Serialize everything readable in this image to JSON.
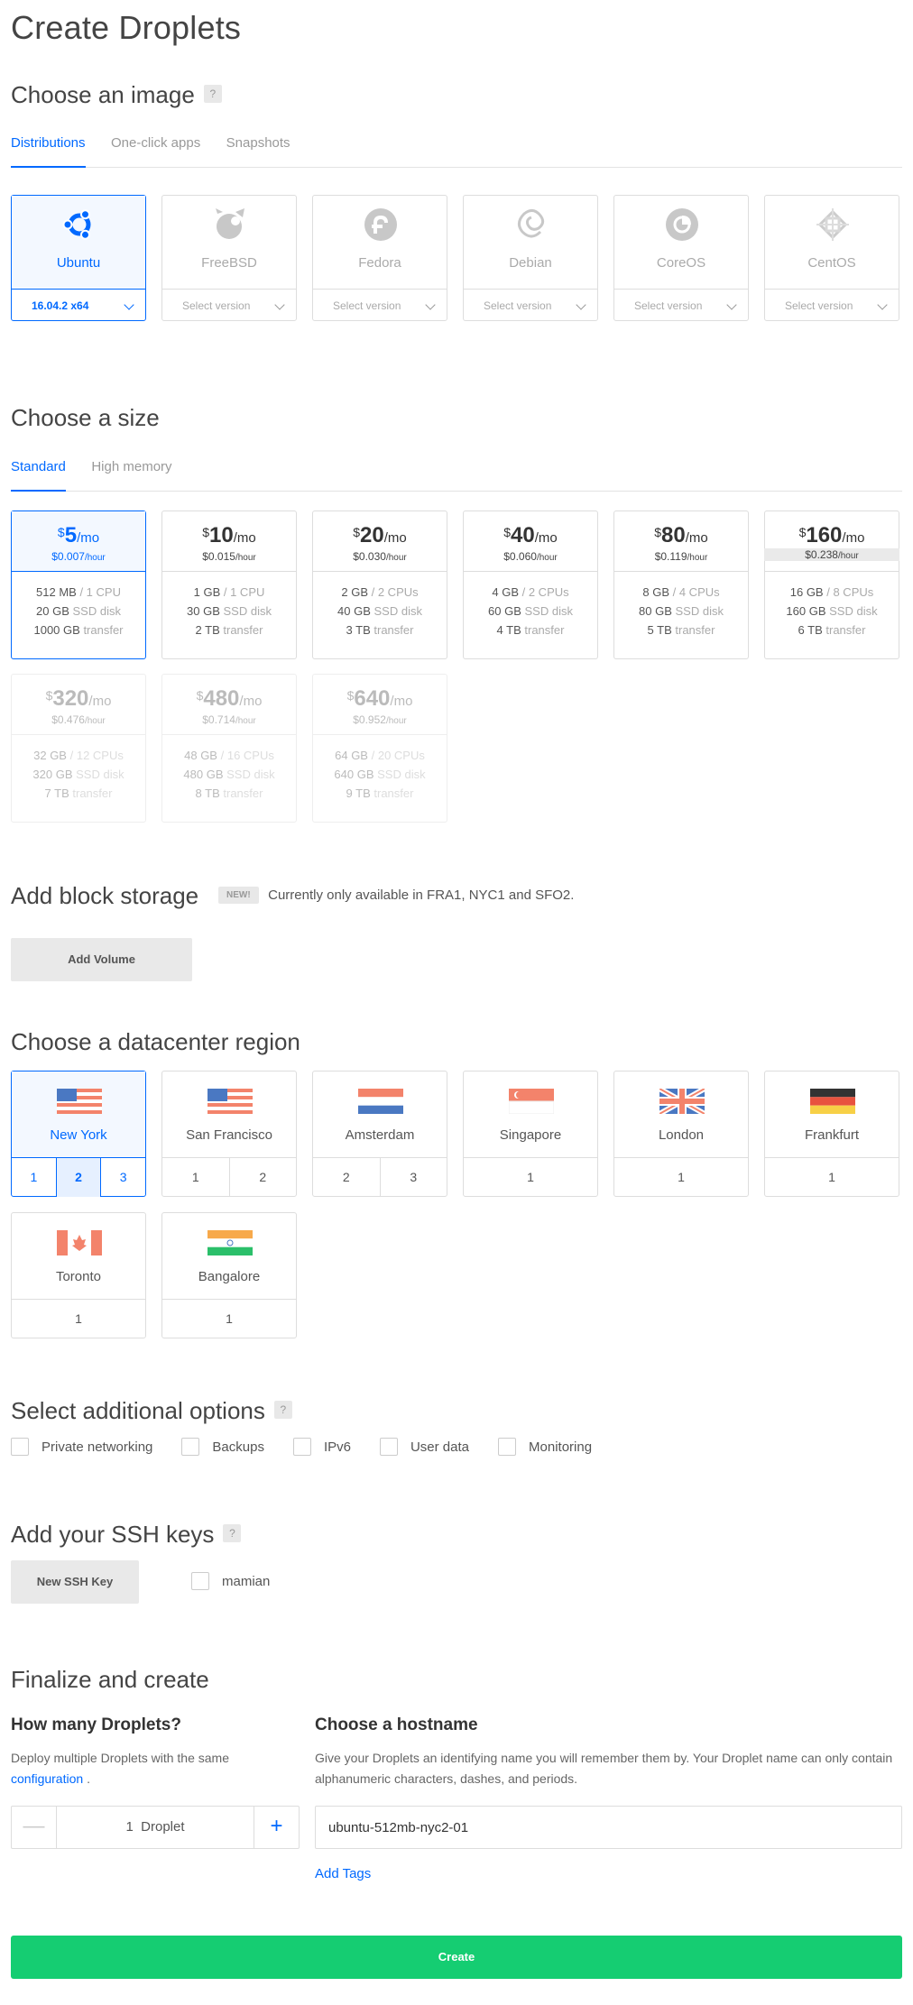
{
  "page_title": "Create Droplets",
  "image_section": {
    "title": "Choose an image",
    "help": "?",
    "tabs": [
      "Distributions",
      "One-click apps",
      "Snapshots"
    ],
    "cards": [
      {
        "name": "Ubuntu",
        "version": "16.04.2 x64",
        "icon": "ubuntu-icon"
      },
      {
        "name": "FreeBSD",
        "version": "Select version",
        "icon": "freebsd-icon"
      },
      {
        "name": "Fedora",
        "version": "Select version",
        "icon": "fedora-icon"
      },
      {
        "name": "Debian",
        "version": "Select version",
        "icon": "debian-icon"
      },
      {
        "name": "CoreOS",
        "version": "Select version",
        "icon": "coreos-icon"
      },
      {
        "name": "CentOS",
        "version": "Select version",
        "icon": "centos-icon"
      }
    ]
  },
  "size_section": {
    "title": "Choose a size",
    "tabs": [
      "Standard",
      "High memory"
    ],
    "currency": "$",
    "per_month": "/mo",
    "per_hour": "/hour",
    "plans": [
      {
        "price": "5",
        "hourly": "$0.007",
        "mem": "512 MB",
        "cpu": "/ 1 CPU",
        "disk": "20 GB",
        "disk_label": "SSD disk",
        "transfer": "1000 GB",
        "transfer_label": "transfer"
      },
      {
        "price": "10",
        "hourly": "$0.015",
        "mem": "1 GB",
        "cpu": "/ 1 CPU",
        "disk": "30 GB",
        "disk_label": "SSD disk",
        "transfer": "2 TB",
        "transfer_label": "transfer"
      },
      {
        "price": "20",
        "hourly": "$0.030",
        "mem": "2 GB",
        "cpu": "/ 2 CPUs",
        "disk": "40 GB",
        "disk_label": "SSD disk",
        "transfer": "3 TB",
        "transfer_label": "transfer"
      },
      {
        "price": "40",
        "hourly": "$0.060",
        "mem": "4 GB",
        "cpu": "/ 2 CPUs",
        "disk": "60 GB",
        "disk_label": "SSD disk",
        "transfer": "4 TB",
        "transfer_label": "transfer"
      },
      {
        "price": "80",
        "hourly": "$0.119",
        "mem": "8 GB",
        "cpu": "/ 4 CPUs",
        "disk": "80 GB",
        "disk_label": "SSD disk",
        "transfer": "5 TB",
        "transfer_label": "transfer"
      },
      {
        "price": "160",
        "hourly": "$0.238",
        "mem": "16 GB",
        "cpu": "/ 8 CPUs",
        "disk": "160 GB",
        "disk_label": "SSD disk",
        "transfer": "6 TB",
        "transfer_label": "transfer"
      },
      {
        "price": "320",
        "hourly": "$0.476",
        "mem": "32 GB",
        "cpu": "/ 12 CPUs",
        "disk": "320 GB",
        "disk_label": "SSD disk",
        "transfer": "7 TB",
        "transfer_label": "transfer"
      },
      {
        "price": "480",
        "hourly": "$0.714",
        "mem": "48 GB",
        "cpu": "/ 16 CPUs",
        "disk": "480 GB",
        "disk_label": "SSD disk",
        "transfer": "8 TB",
        "transfer_label": "transfer"
      },
      {
        "price": "640",
        "hourly": "$0.952",
        "mem": "64 GB",
        "cpu": "/ 20 CPUs",
        "disk": "640 GB",
        "disk_label": "SSD disk",
        "transfer": "9 TB",
        "transfer_label": "transfer"
      }
    ]
  },
  "storage_section": {
    "title": "Add block storage",
    "badge": "NEW!",
    "note": "Currently only available in FRA1, NYC1 and SFO2.",
    "button": "Add Volume"
  },
  "region_section": {
    "title": "Choose a datacenter region",
    "regions": [
      {
        "name": "New York",
        "datacenters": [
          "1",
          "2",
          "3"
        ],
        "flag": "us-flag-icon"
      },
      {
        "name": "San Francisco",
        "datacenters": [
          "1",
          "2"
        ],
        "flag": "us-flag-icon"
      },
      {
        "name": "Amsterdam",
        "datacenters": [
          "2",
          "3"
        ],
        "flag": "nl-flag-icon"
      },
      {
        "name": "Singapore",
        "datacenters": [
          "1"
        ],
        "flag": "sg-flag-icon"
      },
      {
        "name": "London",
        "datacenters": [
          "1"
        ],
        "flag": "uk-flag-icon"
      },
      {
        "name": "Frankfurt",
        "datacenters": [
          "1"
        ],
        "flag": "de-flag-icon"
      },
      {
        "name": "Toronto",
        "datacenters": [
          "1"
        ],
        "flag": "ca-flag-icon"
      },
      {
        "name": "Bangalore",
        "datacenters": [
          "1"
        ],
        "flag": "in-flag-icon"
      }
    ]
  },
  "options_section": {
    "title": "Select additional options",
    "help": "?",
    "options": [
      "Private networking",
      "Backups",
      "IPv6",
      "User data",
      "Monitoring"
    ]
  },
  "ssh_section": {
    "title": "Add your SSH keys",
    "help": "?",
    "button": "New SSH Key",
    "keys": [
      "mamian"
    ]
  },
  "finalize_section": {
    "title": "Finalize and create",
    "count_title": "How many Droplets?",
    "count_desc": "Deploy multiple Droplets with the same",
    "count_link": "configuration",
    "count_link_suffix": ".",
    "count_value": "1",
    "count_unit": "Droplet",
    "minus": "—",
    "plus": "+",
    "host_title": "Choose a hostname",
    "host_desc": "Give your Droplets an identifying name you will remember them by. Your Droplet name can only contain alphanumeric characters, dashes, and periods.",
    "hostname": "ubuntu-512mb-nyc2-01",
    "tags_link": "Add Tags"
  },
  "create_button": "Create",
  "colors": {
    "accent": "#0069ff",
    "create": "#15cd72"
  }
}
